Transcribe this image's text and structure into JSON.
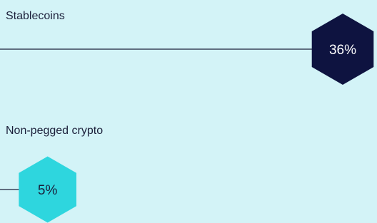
{
  "chart_data": {
    "type": "bar",
    "categories": [
      "Stablecoins",
      "Non-pegged crypto"
    ],
    "values": [
      36,
      5
    ],
    "value_labels": [
      "36%",
      "5%"
    ],
    "unit": "%",
    "colors": {
      "background": "#d3f3f7",
      "line": "#1b1f3a",
      "text": "#1b1f3a",
      "markers": [
        "#0e1340",
        "#2ed6de"
      ],
      "marker_text": [
        "#ffffff",
        "#1b1f3a"
      ]
    }
  }
}
